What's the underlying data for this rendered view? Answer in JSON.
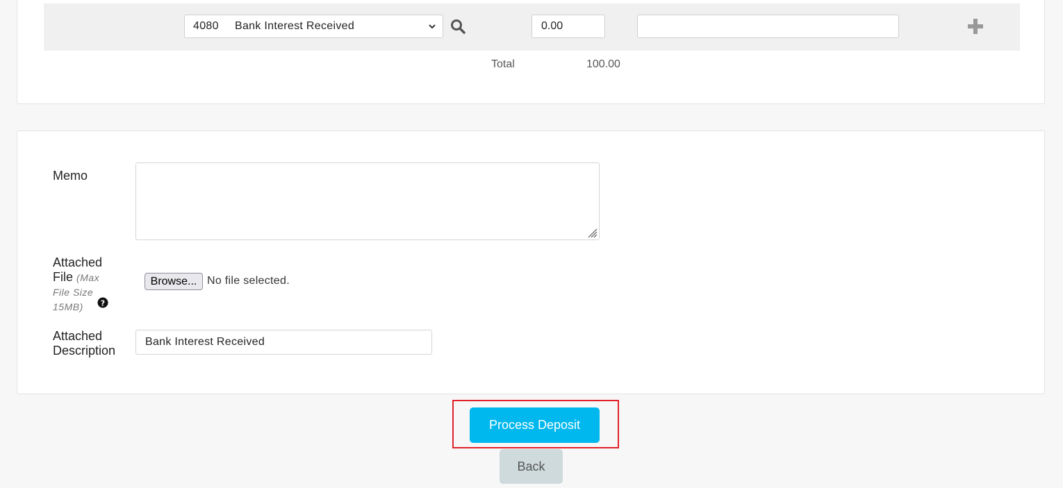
{
  "split": {
    "account_code": "4080",
    "account_name": "Bank Interest Received",
    "amount": "0.00",
    "line_description": ""
  },
  "totals": {
    "label": "Total",
    "value": "100.00"
  },
  "form": {
    "memo_label": "Memo",
    "memo_value": "",
    "file_label": "Attached File",
    "file_hint": "(Max File Size 15MB)",
    "browse_label": "Browse...",
    "file_status": "No file selected.",
    "attached_description_label": "Attached Description",
    "attached_description_value": "Bank Interest Received"
  },
  "actions": {
    "process_label": "Process Deposit",
    "back_label": "Back"
  },
  "colors": {
    "primary_button": "#00b8ee",
    "secondary_button": "#cfdadd",
    "highlight_outline": "#e0202a"
  },
  "icons": [
    "chevron-down-icon",
    "search-icon",
    "plus-icon",
    "question-circle-icon",
    "resize-grip-icon"
  ]
}
